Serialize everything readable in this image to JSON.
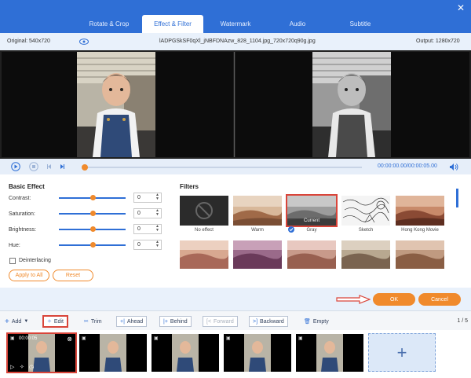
{
  "tabs": [
    {
      "label": "Rotate & Crop",
      "active": false
    },
    {
      "label": "Effect & Filter",
      "active": true
    },
    {
      "label": "Watermark",
      "active": false
    },
    {
      "label": "Audio",
      "active": false
    },
    {
      "label": "Subtitle",
      "active": false
    }
  ],
  "info": {
    "original": "Original: 540x720",
    "filename": "lADPGSkSF0qXl_jNBFDNAzw_828_1104.jpg_720x720q90g.jpg",
    "output": "Output: 1280x720"
  },
  "playback": {
    "time": "00:00:00.00/00:00:05.00",
    "progress": 0.0
  },
  "basic_effect": {
    "title": "Basic Effect",
    "contrast": {
      "label": "Contrast:",
      "value": "0"
    },
    "saturation": {
      "label": "Saturation:",
      "value": "0"
    },
    "brightness": {
      "label": "Brightness:",
      "value": "0"
    },
    "hue": {
      "label": "Hue:",
      "value": "0"
    },
    "deinterlacing": "Deinterlacing",
    "apply_all": "Apply to All",
    "reset": "Reset"
  },
  "filters": {
    "title": "Filters",
    "items": [
      {
        "label": "No effect"
      },
      {
        "label": "Warm"
      },
      {
        "label": "Gray",
        "badge": "Current"
      },
      {
        "label": "Sketch"
      },
      {
        "label": "Hong Kong Movie"
      }
    ]
  },
  "dialog": {
    "ok": "OK",
    "cancel": "Cancel"
  },
  "toolbar": {
    "add": "Add",
    "edit": "Edit",
    "trim": "Trim",
    "ahead": "Ahead",
    "behind": "Behind",
    "forward": "Forward",
    "backward": "Backward",
    "empty": "Empty",
    "pager": "1 / 5"
  },
  "timeline": {
    "first_clip_time": "00:00:05"
  },
  "colors": {
    "accent": "#2f6fd6",
    "orange": "#f08a2c",
    "highlight": "#d9453a"
  }
}
